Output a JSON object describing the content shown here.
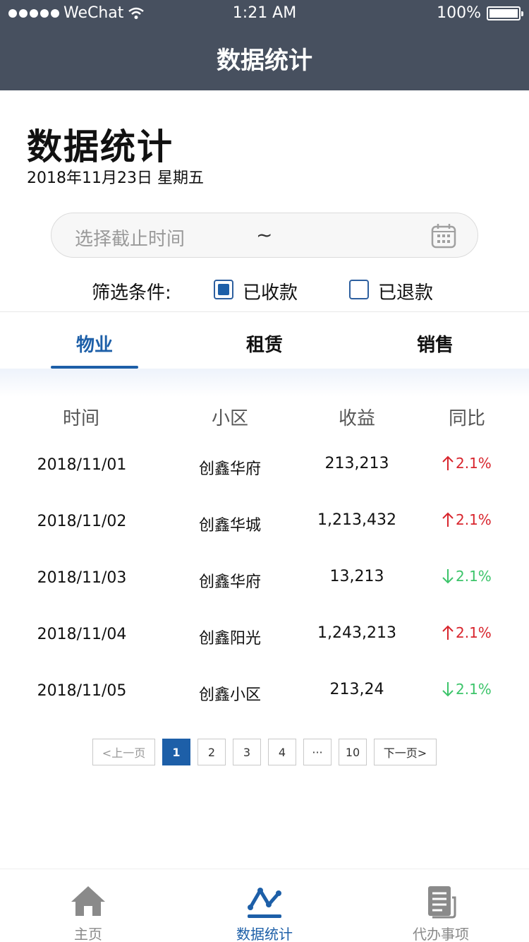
{
  "status_bar": {
    "carrier": "WeChat",
    "time": "1:21 AM",
    "battery": "100%"
  },
  "nav": {
    "title": "数据统计"
  },
  "page": {
    "title": "数据统计",
    "date": "2018年11月23日 星期五"
  },
  "date_picker": {
    "placeholder": "选择截止时间",
    "separator": "~"
  },
  "filter": {
    "label": "筛选条件:",
    "options": [
      {
        "label": "已收款",
        "checked": true
      },
      {
        "label": "已退款",
        "checked": false
      }
    ]
  },
  "tabs": [
    {
      "label": "物业",
      "active": true
    },
    {
      "label": "租赁",
      "active": false
    },
    {
      "label": "销售",
      "active": false
    }
  ],
  "table": {
    "headers": [
      "时间",
      "小区",
      "收益",
      "同比"
    ],
    "rows": [
      {
        "date": "2018/11/01",
        "community": "创鑫华府",
        "revenue": "213,213",
        "yoy": "2.1%",
        "direction": "up"
      },
      {
        "date": "2018/11/02",
        "community": "创鑫华城",
        "revenue": "1,213,432",
        "yoy": "2.1%",
        "direction": "up"
      },
      {
        "date": "2018/11/03",
        "community": "创鑫华府",
        "revenue": "13,213",
        "yoy": "2.1%",
        "direction": "down"
      },
      {
        "date": "2018/11/04",
        "community": "创鑫阳光",
        "revenue": "1,243,213",
        "yoy": "2.1%",
        "direction": "up"
      },
      {
        "date": "2018/11/05",
        "community": "创鑫小区",
        "revenue": "213,24",
        "yoy": "2.1%",
        "direction": "down"
      }
    ]
  },
  "pagination": {
    "prev": "<上一页",
    "pages": [
      "1",
      "2",
      "3",
      "4",
      "···",
      "10"
    ],
    "current": "1",
    "next": "下一页>"
  },
  "tabbar": [
    {
      "label": "主页",
      "icon": "home-icon",
      "active": false
    },
    {
      "label": "数据统计",
      "icon": "stats-icon",
      "active": true
    },
    {
      "label": "代办事项",
      "icon": "todo-icon",
      "active": false
    }
  ],
  "colors": {
    "header_bg": "#47505f",
    "accent": "#1d5fa8",
    "up": "#d8252d",
    "down": "#3cc46a"
  }
}
